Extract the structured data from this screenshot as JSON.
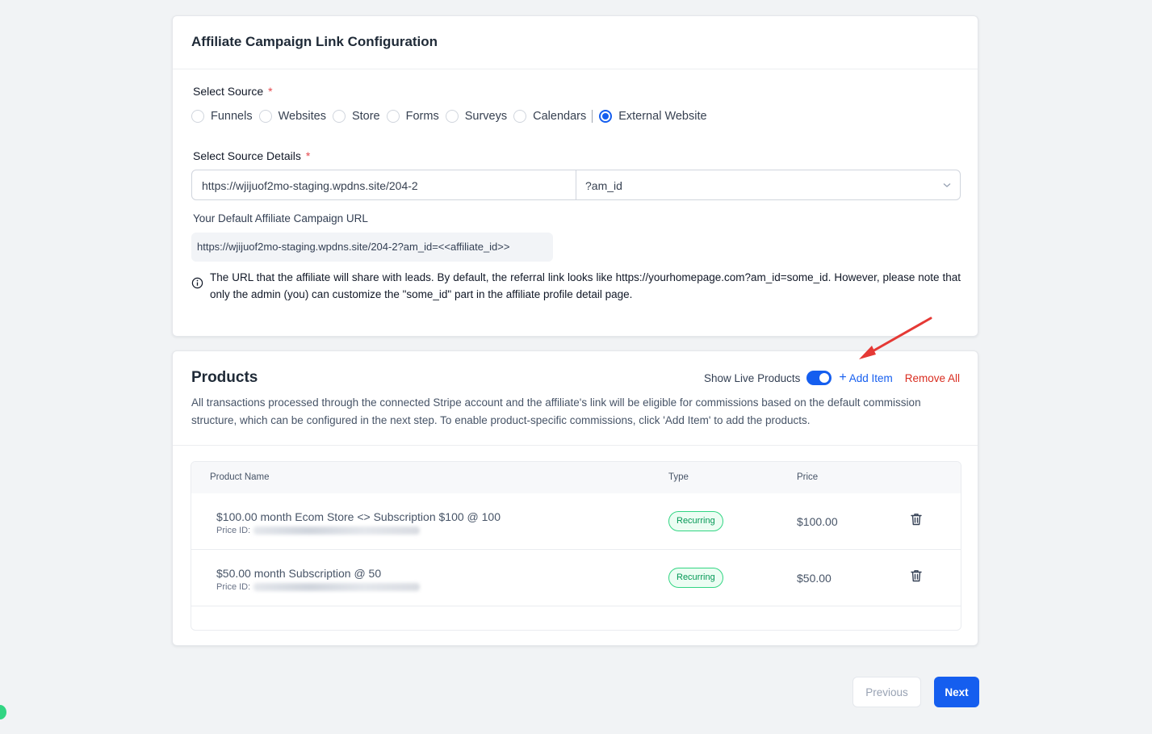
{
  "config_card": {
    "title": "Affiliate Campaign Link Configuration",
    "select_source_label": "Select Source",
    "required_mark": "*",
    "source_options": [
      "Funnels",
      "Websites",
      "Store",
      "Forms",
      "Surveys",
      "Calendars",
      "External Website"
    ],
    "selected_source": "External Website",
    "source_details_label": "Select Source Details",
    "source_url_value": "https://wjijuof2mo-staging.wpdns.site/204-2",
    "param_select_value": "?am_id",
    "default_url_label": "Your Default Affiliate Campaign URL",
    "default_url_value": "https://wjijuof2mo-staging.wpdns.site/204-2?am_id=<<affiliate_id>>",
    "info_text": "The URL that the affiliate will share with leads. By default, the referral link looks like https://yourhomepage.com?am_id=some_id. However, please note that only the admin (you) can customize the \"some_id\" part in the affiliate profile detail page."
  },
  "products_card": {
    "title": "Products",
    "show_live_label": "Show Live Products",
    "show_live_enabled": true,
    "add_item_label": "Add Item",
    "remove_all_label": "Remove All",
    "description": "All transactions processed through the connected Stripe account and the affiliate's link will be eligible for commissions based on the default commission structure, which can be configured in the next step. To enable product-specific commissions, click 'Add Item' to add the products.",
    "columns": [
      "Product Name",
      "Type",
      "Price"
    ],
    "price_id_label": "Price ID:",
    "rows": [
      {
        "name": "$100.00 month Ecom Store <> Subscription $100 @ 100",
        "type": "Recurring",
        "price": "$100.00"
      },
      {
        "name": "$50.00 month Subscription @ 50",
        "type": "Recurring",
        "price": "$50.00"
      }
    ]
  },
  "footer": {
    "previous_label": "Previous",
    "next_label": "Next"
  },
  "colors": {
    "primary": "#155eef",
    "danger": "#d92d20",
    "success": "#039855",
    "annotation_arrow": "#e53935"
  }
}
